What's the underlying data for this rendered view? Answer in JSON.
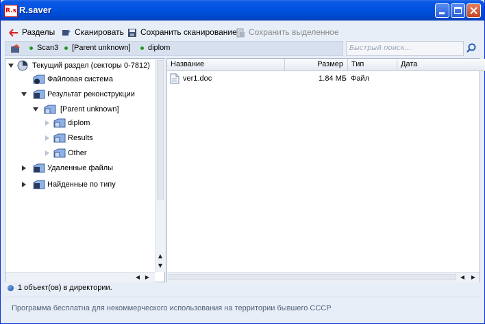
{
  "window": {
    "title": "R.saver",
    "app_icon_text": "R.s"
  },
  "toolbar": {
    "back_label": "Разделы",
    "scan_label": "Сканировать",
    "save_scan_label": "Сохранить сканирование",
    "save_selected_label": "Сохранить выделенное"
  },
  "breadcrumb": {
    "items": [
      "Scan3",
      "[Parent unknown]",
      "diplom"
    ]
  },
  "search": {
    "placeholder": "Быстрый поиск..."
  },
  "tree": {
    "root": "Текущий раздел (секторы 0-7812)",
    "items": [
      "Файловая система",
      "Результат реконструкции",
      "[Parent unknown]",
      "diplom",
      "Results",
      "Other",
      "Удаленные файлы",
      "Найденные по типу"
    ]
  },
  "files": {
    "columns": [
      "Название",
      "Размер",
      "Тип",
      "Дата"
    ],
    "rows": [
      {
        "name": "ver1.doc",
        "size": "1.84 МБ",
        "type": "Файл",
        "date": ""
      }
    ]
  },
  "status": {
    "count_text": "1 объект(ов) в директории.",
    "footer_text": "Программа бесплатна для некоммерческого использования на территории бывшего СССР"
  },
  "colors": {
    "title_bar": "#0053e1",
    "window_bg": "#e8eef7",
    "status_dot": "#1c9a1c",
    "folder": "#8fb3e8"
  }
}
